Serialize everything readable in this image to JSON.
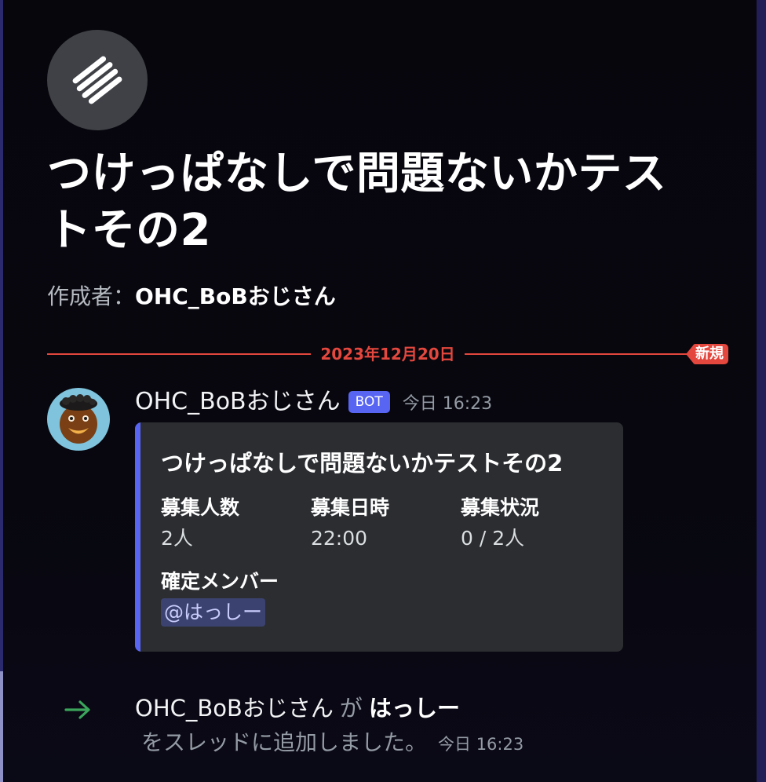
{
  "thread": {
    "title": "つけっぱなしで問題ないかテストその2",
    "creator_label": "作成者：",
    "creator_name": "OHC_BoBおじさん"
  },
  "divider": {
    "date": "2023年12月20日",
    "new_label": "新規",
    "color": "#e4473d"
  },
  "message": {
    "author": "OHC_BoBおじさん",
    "bot_tag": "BOT",
    "timestamp": "今日 16:23",
    "embed": {
      "accent_color": "#5865f2",
      "title": "つけっぱなしで問題ないかテストその2",
      "fields": [
        {
          "name": "募集人数",
          "value": "2人"
        },
        {
          "name": "募集日時",
          "value": "22:00"
        },
        {
          "name": "募集状況",
          "value": "0 / 2人"
        }
      ],
      "members_label": "確定メンバー",
      "members_value": "@はっしー"
    }
  },
  "system_message": {
    "icon": "arrow-right-icon",
    "actor": "OHC_BoBおじさん",
    "connector": "が",
    "target": "はっしー",
    "text": "をスレッドに追加しました。",
    "timestamp": "今日 16:23"
  },
  "icons": {
    "thread_icon": "thread-icon",
    "avatar": "avatar"
  }
}
